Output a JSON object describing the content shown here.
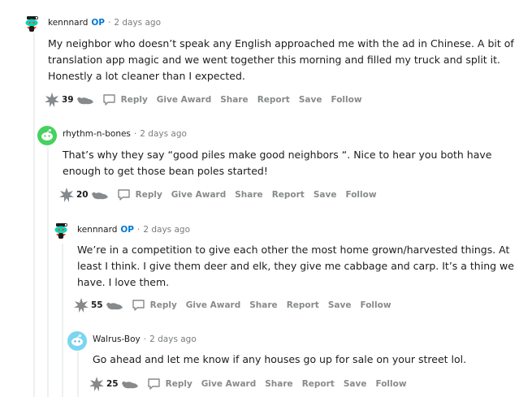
{
  "comments": [
    {
      "author": "kennnard",
      "op_label": "OP",
      "separator": "·",
      "time": "2 days ago",
      "body": "My neighbor who doesn’t speak any English approached me with the ad in Chinese. A bit of translation app magic and we went together this morning and filled my truck and split it. Honestly a lot cleaner than I expected.",
      "score": "39",
      "actions": {
        "reply": "Reply",
        "award": "Give Award",
        "share": "Share",
        "report": "Report",
        "save": "Save",
        "follow": "Follow"
      }
    },
    {
      "author": "rhythm-n-bones",
      "separator": "·",
      "time": "2 days ago",
      "body": "That’s why they say “good piles make good neighbors “. Nice to hear you both have enough to get those bean poles started!",
      "score": "20",
      "actions": {
        "reply": "Reply",
        "award": "Give Award",
        "share": "Share",
        "report": "Report",
        "save": "Save",
        "follow": "Follow"
      }
    },
    {
      "author": "kennnard",
      "op_label": "OP",
      "separator": "·",
      "time": "2 days ago",
      "body": "We’re in a competition to give each other the most home grown/harvested things. At least I think. I give them deer and elk, they give me cabbage and carp. It’s a thing we have. I love them.",
      "score": "55",
      "actions": {
        "reply": "Reply",
        "award": "Give Award",
        "share": "Share",
        "report": "Report",
        "save": "Save",
        "follow": "Follow"
      }
    },
    {
      "author": "Walrus-Boy",
      "separator": "·",
      "time": "2 days ago",
      "body": "Go ahead and let me know if any houses go up for sale on your street lol.",
      "score": "25",
      "actions": {
        "reply": "Reply",
        "award": "Give Award",
        "share": "Share",
        "report": "Report",
        "save": "Save",
        "follow": "Follow"
      }
    }
  ],
  "colors": {
    "op": "#0079d3",
    "meta": "#787c7e",
    "action": "#878a8c",
    "thread_line": "#edeff1",
    "snoo_green": "#46d160",
    "snoo_teal": "#0dd3bb",
    "snoo_sky": "#24a0ed"
  }
}
